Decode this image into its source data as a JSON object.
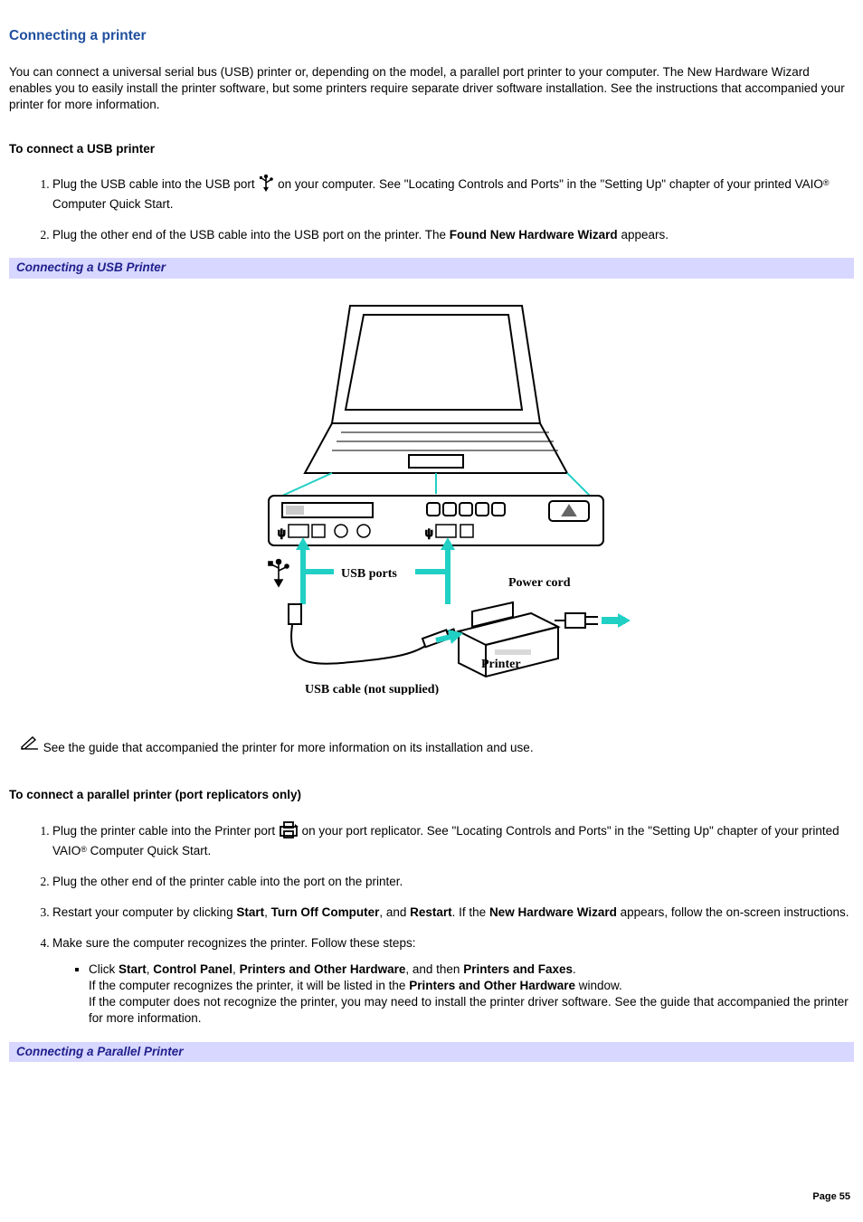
{
  "title": "Connecting a printer",
  "intro": "You can connect a universal serial bus (USB) printer or, depending on the model, a parallel port printer to your computer. The New Hardware Wizard enables you to easily install the printer software, but some printers require separate driver software installation. See the instructions that accompanied your printer for more information.",
  "section_usb": {
    "heading": "To connect a USB printer",
    "step1_a": "Plug the USB cable into the USB port ",
    "step1_b": " on your computer. See \"Locating Controls and Ports\" in the \"Setting Up\" chapter of your printed VAIO",
    "step1_c": " Computer Quick Start.",
    "step2_a": "Plug the other end of the USB cable into the USB port on the printer. The ",
    "step2_bold": "Found New Hardware Wizard",
    "step2_b": " appears.",
    "caption": "Connecting a USB Printer"
  },
  "figure": {
    "label_usb_ports": "USB ports",
    "label_power_cord": "Power cord",
    "label_printer": "Printer",
    "label_cable": "USB cable (not supplied)"
  },
  "note_text": " See the guide that accompanied the printer for more information on its installation and use.",
  "section_parallel": {
    "heading": "To connect a parallel printer (port replicators only)",
    "step1_a": "Plug the printer cable into the Printer port ",
    "step1_b": " on your port replicator. See \"Locating Controls and Ports\" in the \"Setting Up\" chapter of your printed VAIO",
    "step1_c": " Computer Quick Start.",
    "step2": "Plug the other end of the printer cable into the port on the printer.",
    "step3_a": "Restart your computer by clicking ",
    "step3_start": "Start",
    "step3_sep1": ", ",
    "step3_off": "Turn Off Computer",
    "step3_sep2": ", and ",
    "step3_restart": "Restart",
    "step3_b": ". If the ",
    "step3_wizard": "New Hardware Wizard",
    "step3_c": " appears, follow the on-screen instructions.",
    "step4": "Make sure the computer recognizes the printer. Follow these steps:",
    "sub_a1": "Click ",
    "sub_start": "Start",
    "sub_sep1": ", ",
    "sub_cp": "Control Panel",
    "sub_sep2": ", ",
    "sub_poh": "Printers and Other Hardware",
    "sub_sep3": ", and then ",
    "sub_pf": "Printers and Faxes",
    "sub_a2": ".",
    "sub_line2a": "If the computer recognizes the printer, it will be listed in the ",
    "sub_line2b": "Printers and Other Hardware",
    "sub_line2c": " window.",
    "sub_line3": "If the computer does not recognize the printer, you may need to install the printer driver software. See the guide that accompanied the printer for more information.",
    "caption": "Connecting a Parallel Printer"
  },
  "reg_mark": "®",
  "page_number": "Page 55"
}
